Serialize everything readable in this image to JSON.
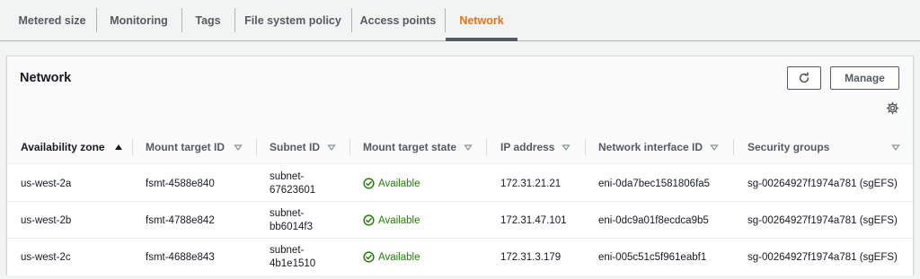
{
  "tabs": [
    {
      "label": "Metered size",
      "active": false
    },
    {
      "label": "Monitoring",
      "active": false
    },
    {
      "label": "Tags",
      "active": false
    },
    {
      "label": "File system policy",
      "active": false
    },
    {
      "label": "Access points",
      "active": false
    },
    {
      "label": "Network",
      "active": true
    }
  ],
  "panel": {
    "title": "Network",
    "refresh_icon": "refresh-icon",
    "manage_label": "Manage",
    "settings_icon": "gear-icon"
  },
  "table": {
    "columns": [
      {
        "label": "Availability zone",
        "sort": "ascending"
      },
      {
        "label": "Mount target ID",
        "sort": "none"
      },
      {
        "label": "Subnet ID",
        "sort": "none"
      },
      {
        "label": "Mount target state",
        "sort": "none"
      },
      {
        "label": "IP address",
        "sort": "none"
      },
      {
        "label": "Network interface ID",
        "sort": "none"
      },
      {
        "label": "Security groups",
        "sort": "none"
      }
    ],
    "rows": [
      {
        "availability_zone": "us-west-2a",
        "mount_target_id": "fsmt-4588e840",
        "subnet_line1": "subnet-",
        "subnet_line2": "67623601",
        "state": "Available",
        "ip_address": "172.31.21.21",
        "network_interface_id": "eni-0da7bec1581806fa5",
        "security_groups": "sg-00264927f1974a781 (sgEFS)"
      },
      {
        "availability_zone": "us-west-2b",
        "mount_target_id": "fsmt-4788e842",
        "subnet_line1": "subnet-",
        "subnet_line2": "bb6014f3",
        "state": "Available",
        "ip_address": "172.31.47.101",
        "network_interface_id": "eni-0dc9a01f8ecdca9b5",
        "security_groups": "sg-00264927f1974a781 (sgEFS)"
      },
      {
        "availability_zone": "us-west-2c",
        "mount_target_id": "fsmt-4688e843",
        "subnet_line1": "subnet-",
        "subnet_line2": "4b1e1510",
        "state": "Available",
        "ip_address": "172.31.3.179",
        "network_interface_id": "eni-005c51c5f961eabf1",
        "security_groups": "sg-00264927f1974a781 (sgEFS)"
      }
    ]
  },
  "colors": {
    "accent": "#ec7211",
    "status_success": "#1d8102",
    "text": "#16191f",
    "muted": "#545b64"
  }
}
